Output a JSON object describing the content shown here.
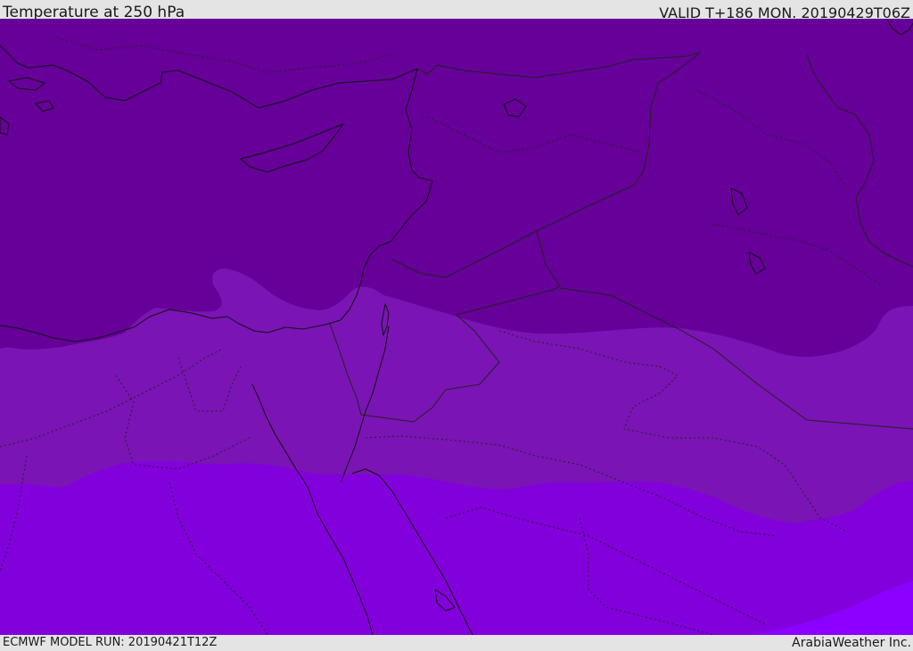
{
  "header": {
    "title": "Temperature at 250 hPa",
    "valid_time": "VALID T+186 MON. 20190429T06Z"
  },
  "footer": {
    "model_run": "ECMWF MODEL RUN: 20190421T12Z",
    "credit": "ArabiaWeather Inc."
  },
  "colors": {
    "band_coldest": "#660099",
    "band_middle": "#7a14b4",
    "band_warm": "#8200dc",
    "band_warmest": "#8c00ff",
    "coastline": "#111111",
    "borders": "#222222"
  }
}
